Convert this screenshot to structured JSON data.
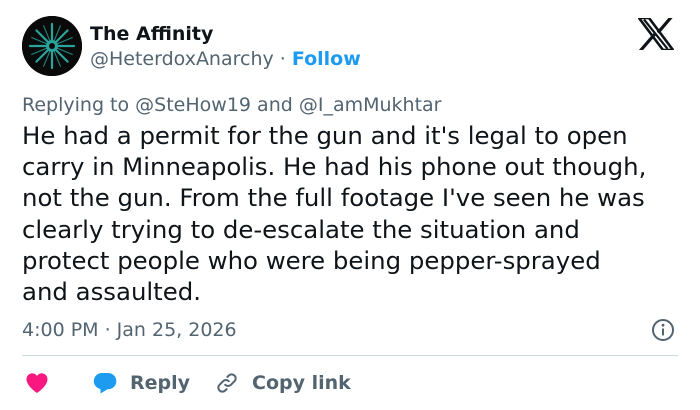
{
  "author": {
    "name": "The Affinity",
    "handle": "@HeterdoxAnarchy",
    "separator": "·",
    "follow_label": "Follow"
  },
  "reply_context": {
    "prefix": "Replying to",
    "mention_1": "@SteHow19",
    "conjunction": "and",
    "mention_2": "@I_amMukhtar"
  },
  "tweet": {
    "text": "He had a permit for the gun and it's legal to open\ncarry in Minneapolis. He had his phone out though,\nnot the gun. From the full footage I've seen he was\nclearly trying to de-escalate the situation and\nprotect people who were being pepper-sprayed\nand assaulted.",
    "timestamp": "4:00 PM · Jan 25, 2026"
  },
  "actions": {
    "reply_label": "Reply",
    "copy_link_label": "Copy link"
  },
  "icons": {
    "platform": "x-logo-icon",
    "avatar": "starburst-avatar-icon",
    "info": "info-icon",
    "like": "heart-icon",
    "reply": "speech-bubble-icon",
    "copy": "link-icon"
  },
  "colors": {
    "accent": "#1d9bf0",
    "like": "#f91880",
    "text": "#0f1419",
    "secondary": "#536471",
    "divider": "#cfd9de"
  }
}
